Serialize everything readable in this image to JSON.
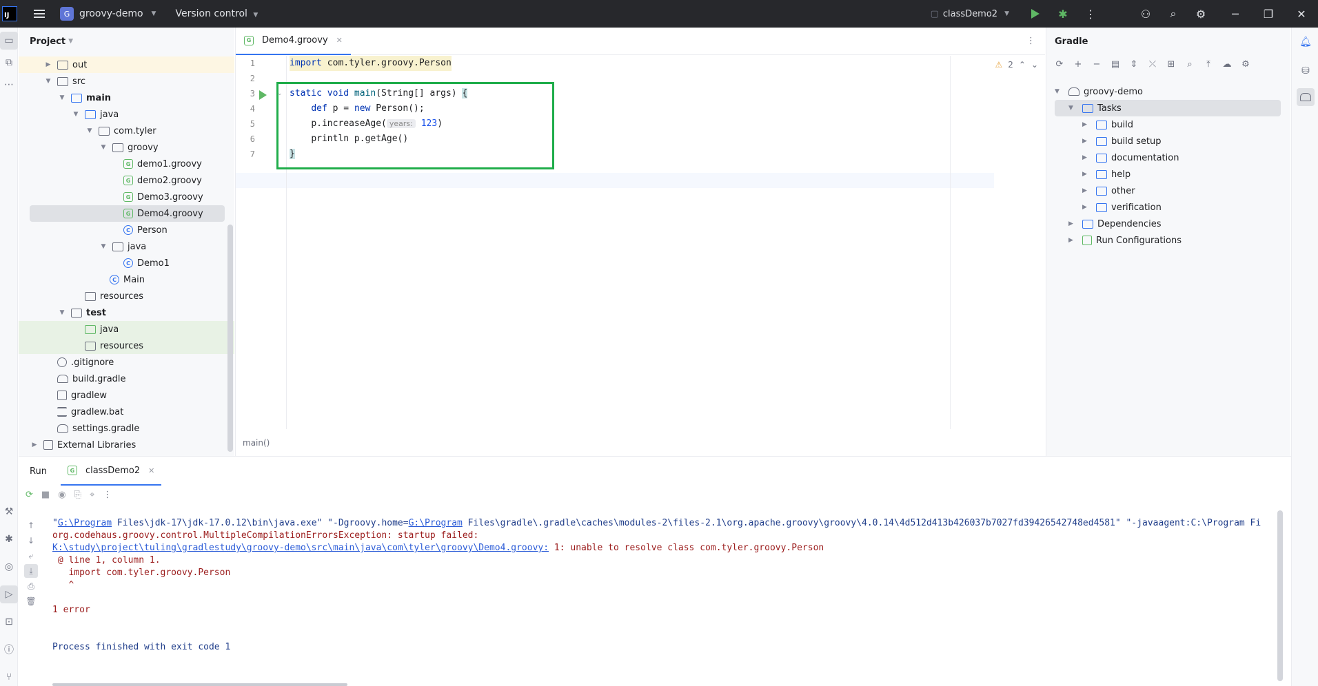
{
  "titlebar": {
    "logo": "IJ",
    "project_initial": "G",
    "project_name": "groovy-demo",
    "vcs_label": "Version control",
    "run_config": "classDemo2"
  },
  "project_panel": {
    "title": "Project",
    "items": [
      {
        "label": "out"
      },
      {
        "label": "src"
      },
      {
        "label": "main"
      },
      {
        "label": "java"
      },
      {
        "label": "com.tyler"
      },
      {
        "label": "groovy"
      },
      {
        "label": "demo1.groovy"
      },
      {
        "label": "demo2.groovy"
      },
      {
        "label": "Demo3.groovy"
      },
      {
        "label": "Demo4.groovy"
      },
      {
        "label": "Person"
      },
      {
        "label": "java"
      },
      {
        "label": "Demo1"
      },
      {
        "label": "Main"
      },
      {
        "label": "resources"
      },
      {
        "label": "test"
      },
      {
        "label": "java"
      },
      {
        "label": "resources"
      },
      {
        "label": ".gitignore"
      },
      {
        "label": "build.gradle"
      },
      {
        "label": "gradlew"
      },
      {
        "label": "gradlew.bat"
      },
      {
        "label": "settings.gradle"
      },
      {
        "label": "External Libraries"
      }
    ]
  },
  "editor": {
    "tab_label": "Demo4.groovy",
    "line_numbers": [
      "1",
      "2",
      "3",
      "4",
      "5",
      "6",
      "7"
    ],
    "code": {
      "l1_kw": "import",
      "l1_rest": " com.tyler.groovy.Person",
      "l3_a": "static void ",
      "l3_fn": "main",
      "l3_b": "(String[] args) ",
      "l3_brace": "{",
      "l4_kw": "def",
      "l4_b": " p = ",
      "l4_new": "new",
      "l4_c": " Person();",
      "l5_a": "p.increaseAge(",
      "l5_hint": "years:",
      "l5_num": "123",
      "l5_b": ")",
      "l6": "println p.getAge()",
      "l7_brace": "}"
    },
    "warning_count": "2",
    "breadcrumb": "main()"
  },
  "gradle": {
    "title": "Gradle",
    "root": "groovy-demo",
    "tasks_label": "Tasks",
    "tasks": [
      "build",
      "build setup",
      "documentation",
      "help",
      "other",
      "verification"
    ],
    "dependencies": "Dependencies",
    "run_configs": "Run Configurations"
  },
  "run": {
    "title": "Run",
    "tab_label": "classDemo2",
    "console": {
      "l1_q1": "\"",
      "l1_link1": "G:\\Program",
      "l1_mid": " Files\\jdk-17\\jdk-17.0.12\\bin\\java.exe\" \"-Dgroovy.home=",
      "l1_link2": "G:\\Program",
      "l1_rest": " Files\\gradle\\.gradle\\caches\\modules-2\\files-2.1\\org.apache.groovy\\groovy\\4.0.14\\4d512d413b426037b7027fd39426542748ed4581\" \"-javaagent:C:\\Program Fi",
      "l2": "org.codehaus.groovy.control.MultipleCompilationErrorsException: startup failed:",
      "l3_link": "K:\\study\\project\\tuling\\gradlestudy\\groovy-demo\\src\\main\\java\\com\\tyler\\groovy\\Demo4.groovy:",
      "l3_rest": " 1: unable to resolve class com.tyler.groovy.Person",
      "l4": " @ line 1, column 1.",
      "l5": "   import com.tyler.groovy.Person",
      "l6": "   ^",
      "l8": "1 error",
      "l11": "Process finished with exit code 1"
    }
  },
  "colors": {
    "accent": "#3574f0",
    "highlight_box": "#1fad4a",
    "error_text": "#9b1c1c",
    "titlebar_bg": "#27282c"
  }
}
